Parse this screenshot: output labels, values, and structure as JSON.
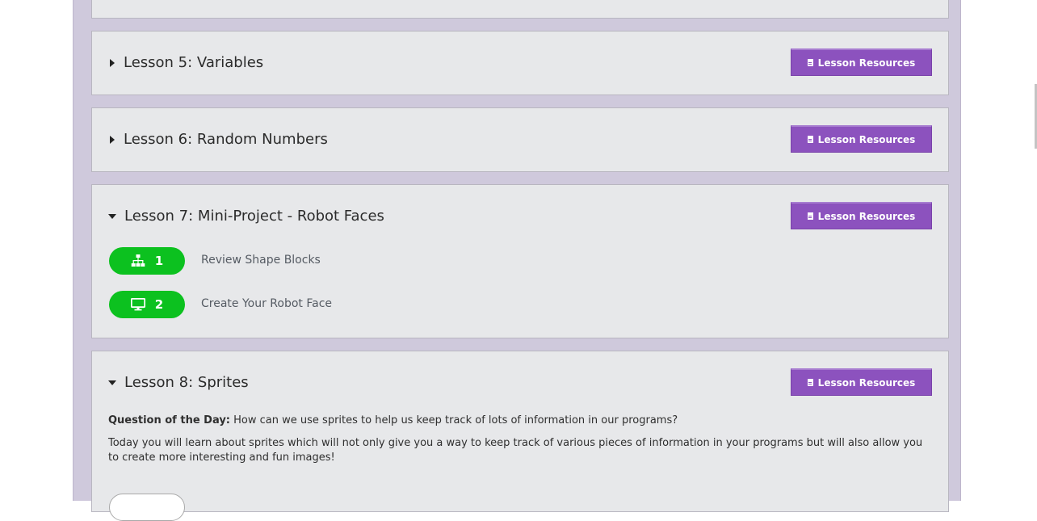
{
  "lessons": [
    {
      "title": "Lesson 5: Variables",
      "resources": "Lesson Resources"
    },
    {
      "title": "Lesson 6: Random Numbers",
      "resources": "Lesson Resources"
    },
    {
      "title": "Lesson 7: Mini-Project - Robot Faces",
      "resources": "Lesson Resources",
      "activities": [
        {
          "number": "1",
          "label": "Review Shape Blocks",
          "icon": "sitemap-icon"
        },
        {
          "number": "2",
          "label": "Create Your Robot Face",
          "icon": "desktop-icon"
        }
      ]
    },
    {
      "title": "Lesson 8: Sprites",
      "resources": "Lesson Resources",
      "question_label": "Question of the Day:",
      "question": "How can we use sprites to help us keep track of lots of information in our programs?",
      "description": "Today you will learn about sprites which will not only give you a way to keep track of various pieces of information in your programs but will also allow you to create more interesting and fun images!"
    }
  ],
  "colors": {
    "accent": "#8c52be",
    "green": "#0cc11f",
    "panel": "#cfc9dc"
  }
}
